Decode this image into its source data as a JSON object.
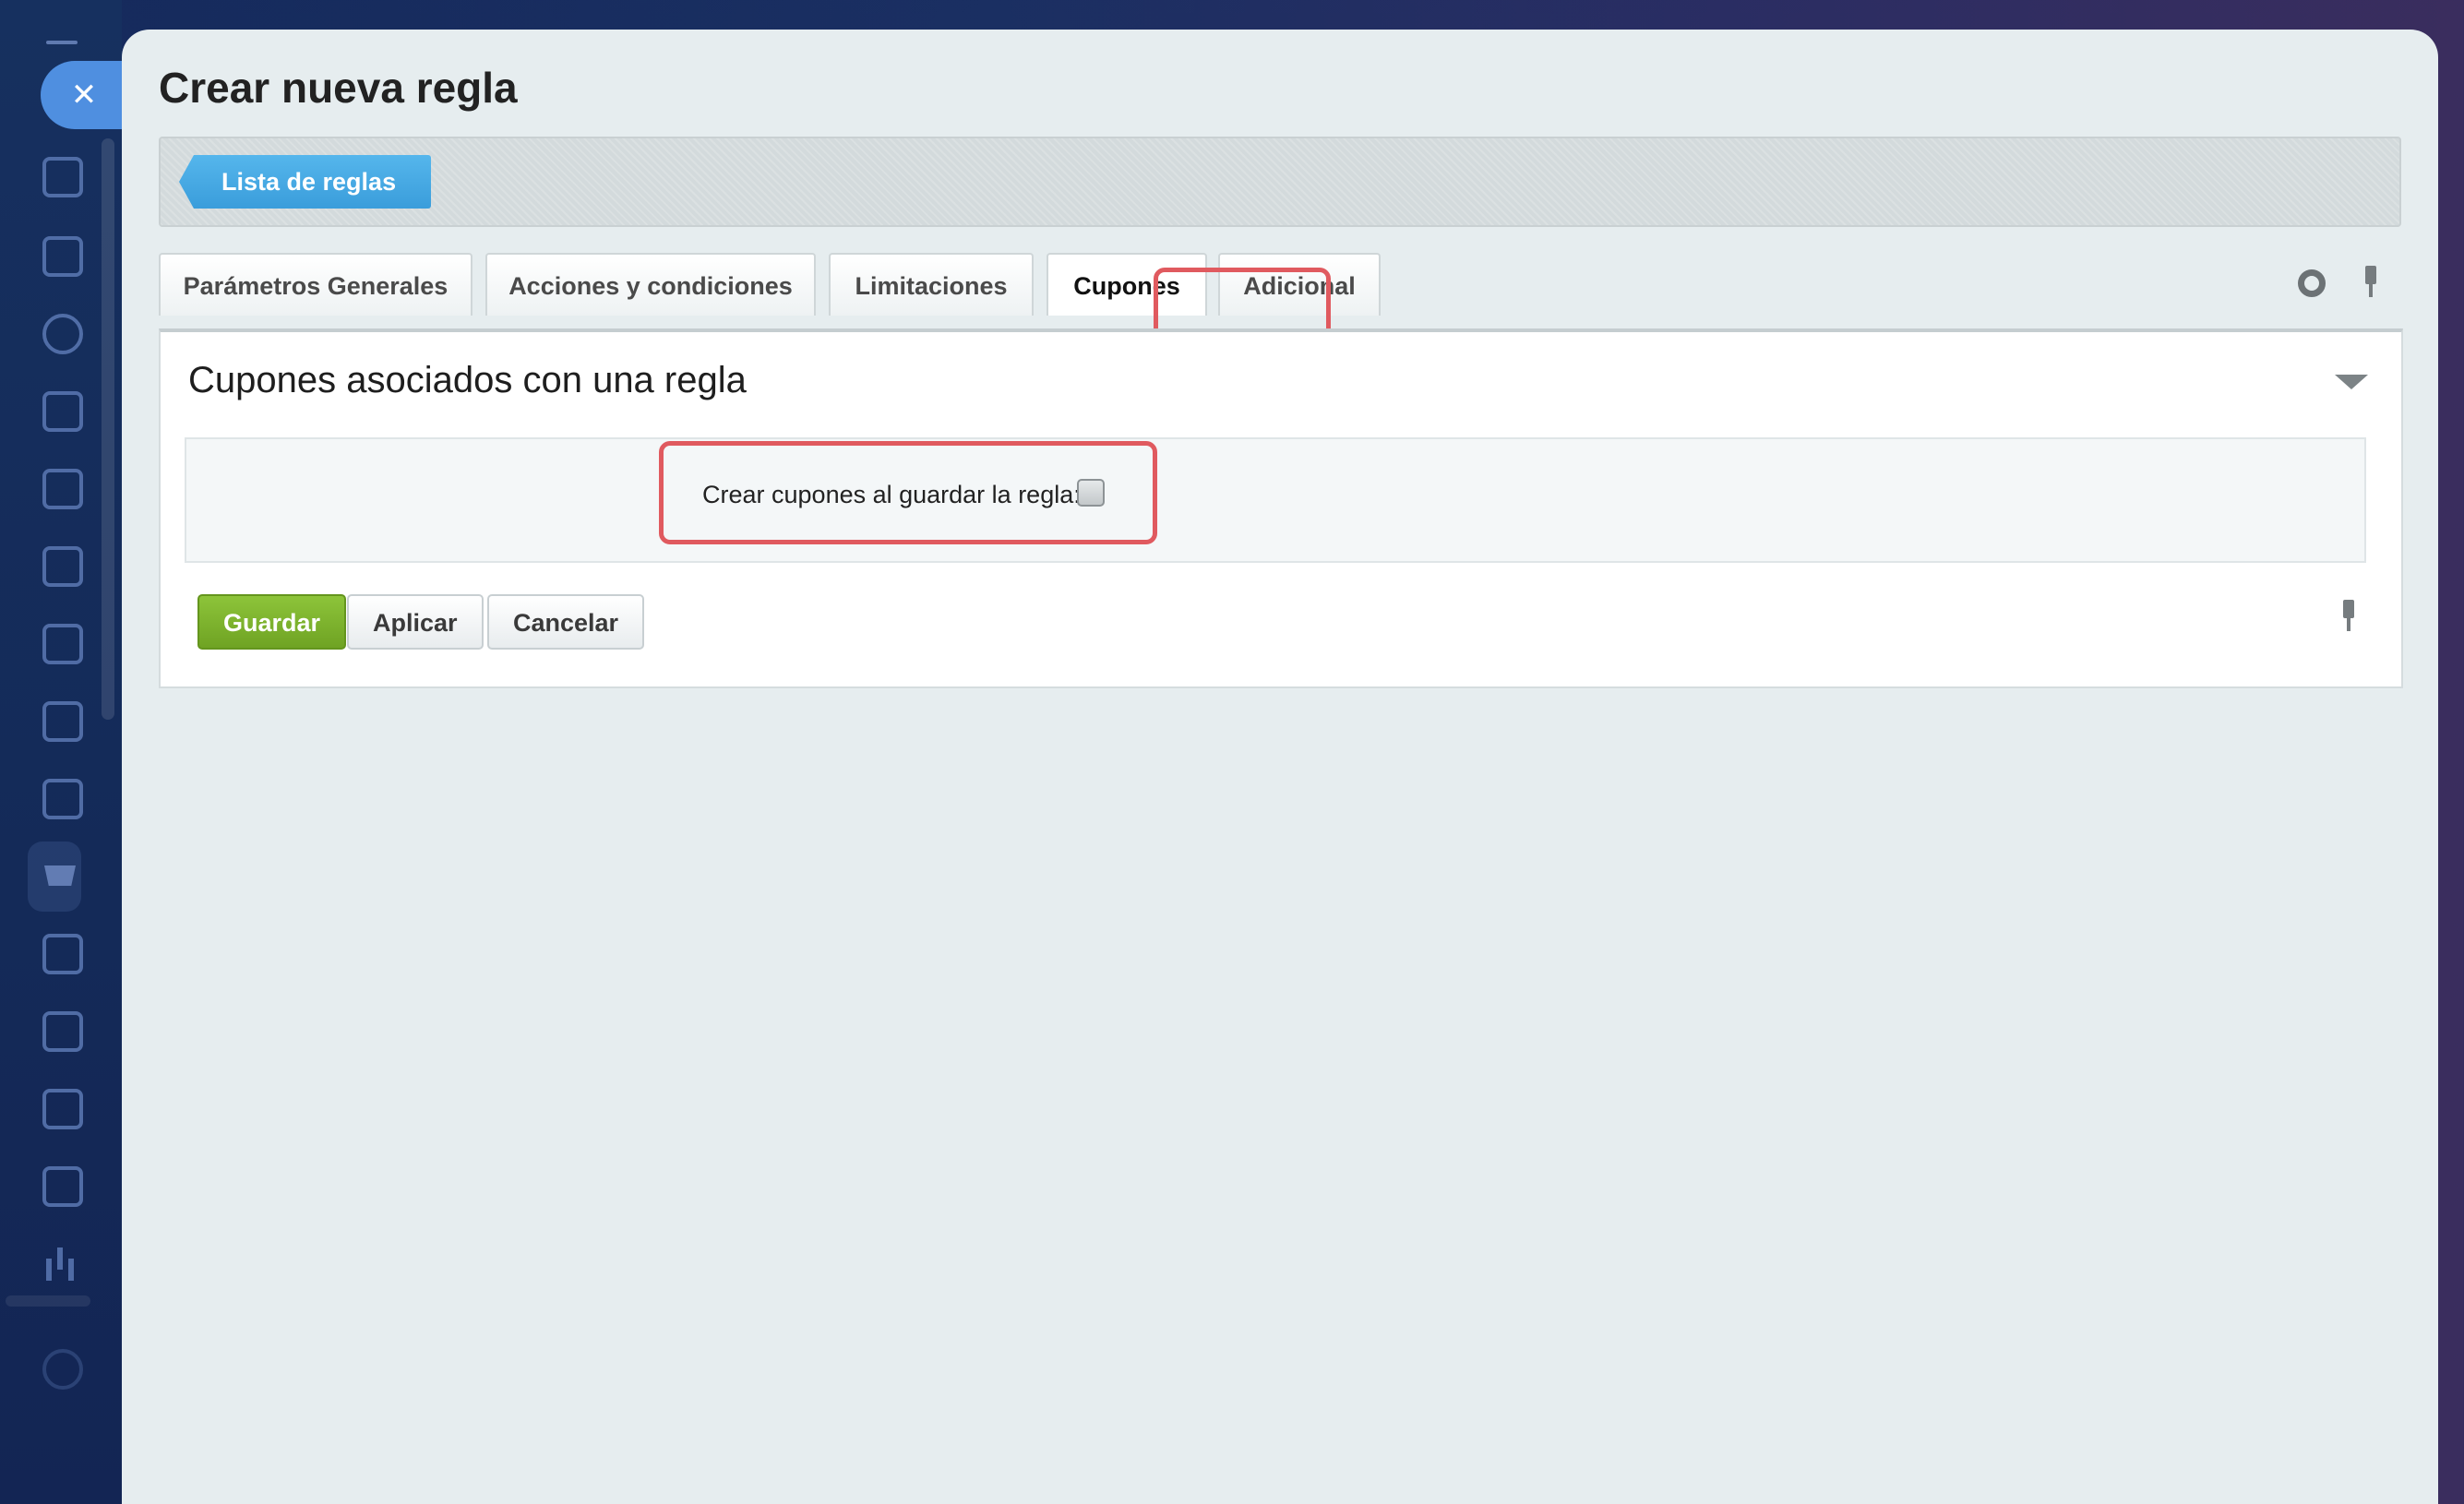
{
  "page": {
    "title": "Crear nueva regla"
  },
  "toolbar": {
    "back_label": "Lista de reglas"
  },
  "tabs": [
    {
      "label": "Parámetros Generales",
      "active": false
    },
    {
      "label": "Acciones y condiciones",
      "active": false
    },
    {
      "label": "Limitaciones",
      "active": false
    },
    {
      "label": "Cupones",
      "active": true
    },
    {
      "label": "Adicional",
      "active": false
    }
  ],
  "section": {
    "title": "Cupones asociados con una regla",
    "field": {
      "label": "Crear cupones al guardar la regla:",
      "checked": false
    }
  },
  "buttons": {
    "save": "Guardar",
    "apply": "Aplicar",
    "cancel": "Cancelar"
  },
  "colors": {
    "accent_blue": "#3a9ddb",
    "save_green": "#6fa323",
    "highlight_red": "#e05a5f"
  },
  "sidebar": {
    "icons": [
      "menu-icon",
      "close-icon",
      "feed-icon",
      "funnel-icon",
      "target-icon",
      "chat-icon",
      "edit-doc-icon",
      "checkbox-icon",
      "calendar-grid-icon",
      "card-icon",
      "calendar-icon",
      "cart-icon",
      "store-icon",
      "document-icon",
      "robot-icon",
      "presentation-icon",
      "chart-icon",
      "settings-icon"
    ]
  }
}
